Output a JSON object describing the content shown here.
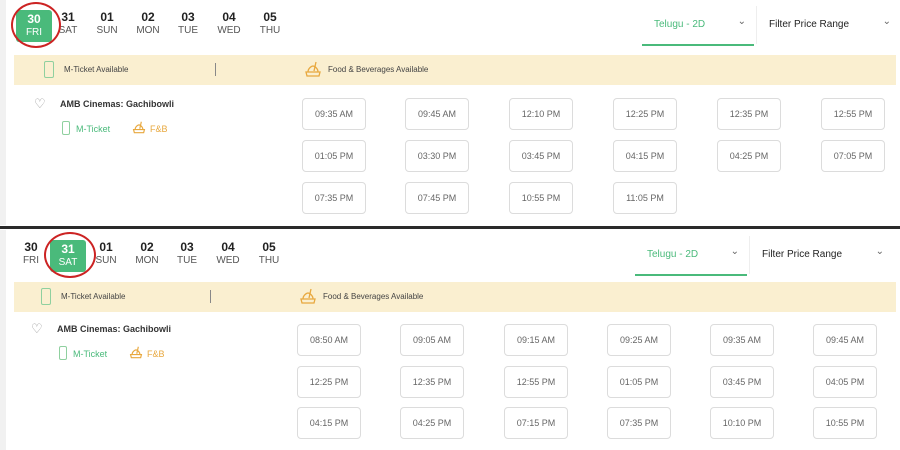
{
  "panels": [
    {
      "dates": [
        {
          "num": "30",
          "dow": "FRI",
          "selected": true
        },
        {
          "num": "31",
          "dow": "SAT",
          "selected": false
        },
        {
          "num": "01",
          "dow": "SUN",
          "selected": false
        },
        {
          "num": "02",
          "dow": "MON",
          "selected": false
        },
        {
          "num": "03",
          "dow": "TUE",
          "selected": false
        },
        {
          "num": "04",
          "dow": "WED",
          "selected": false
        },
        {
          "num": "05",
          "dow": "THU",
          "selected": false
        }
      ],
      "language": "Telugu - 2D",
      "price_filter": "Filter Price Range",
      "banner": {
        "mticket": "M-Ticket Available",
        "food": "Food & Beverages Available"
      },
      "cinema": {
        "name": "AMB Cinemas: Gachibowli",
        "tag_mticket": "M-Ticket",
        "tag_fb": "F&B"
      },
      "showtimes": [
        [
          "09:35 AM",
          "09:45 AM",
          "12:10 PM",
          "12:25 PM",
          "12:35 PM",
          "12:55 PM"
        ],
        [
          "01:05 PM",
          "03:30 PM",
          "03:45 PM",
          "04:15 PM",
          "04:25 PM",
          "07:05 PM"
        ],
        [
          "07:35 PM",
          "07:45 PM",
          "10:55 PM",
          "11:05 PM"
        ]
      ]
    },
    {
      "dates": [
        {
          "num": "30",
          "dow": "FRI",
          "selected": false
        },
        {
          "num": "31",
          "dow": "SAT",
          "selected": true
        },
        {
          "num": "01",
          "dow": "SUN",
          "selected": false
        },
        {
          "num": "02",
          "dow": "MON",
          "selected": false
        },
        {
          "num": "03",
          "dow": "TUE",
          "selected": false
        },
        {
          "num": "04",
          "dow": "WED",
          "selected": false
        },
        {
          "num": "05",
          "dow": "THU",
          "selected": false
        }
      ],
      "language": "Telugu - 2D",
      "price_filter": "Filter Price Range",
      "banner": {
        "mticket": "M-Ticket Available",
        "food": "Food & Beverages Available"
      },
      "cinema": {
        "name": "AMB Cinemas: Gachibowli",
        "tag_mticket": "M-Ticket",
        "tag_fb": "F&B"
      },
      "showtimes": [
        [
          "08:50 AM",
          "09:05 AM",
          "09:15 AM",
          "09:25 AM",
          "09:35 AM",
          "09:45 AM"
        ],
        [
          "12:25 PM",
          "12:35 PM",
          "12:55 PM",
          "01:05 PM",
          "03:45 PM",
          "04:05 PM"
        ],
        [
          "04:15 PM",
          "04:25 PM",
          "07:15 PM",
          "07:35 PM",
          "10:10 PM",
          "10:55 PM"
        ]
      ]
    }
  ],
  "colors": {
    "accent": "#4aba7b",
    "banner_bg": "#faefd0",
    "annotation": "#cc2323",
    "fb": "#e8a83e"
  },
  "icons": {
    "heart": "heart-icon",
    "chevron": "chevron-down-icon",
    "phone": "mobile-ticket-icon",
    "food": "food-beverage-icon"
  }
}
